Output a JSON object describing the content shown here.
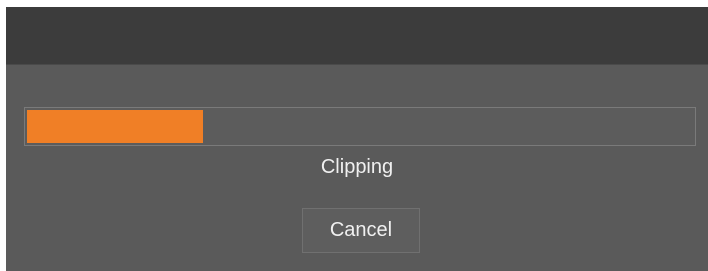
{
  "progress": {
    "fraction": 0.265,
    "color": "#f07f26"
  },
  "status": {
    "label": "Clipping"
  },
  "actions": {
    "cancel_label": "Cancel"
  },
  "theme": {
    "dialog_bg": "#5a5a5a",
    "titlebar_bg": "#3c3c3c"
  }
}
